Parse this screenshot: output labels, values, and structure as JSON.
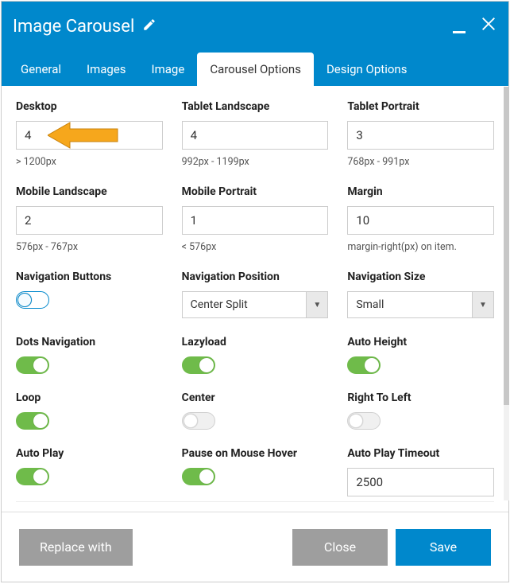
{
  "header": {
    "title": "Image Carousel"
  },
  "tabs": [
    "General",
    "Images",
    "Image",
    "Carousel Options",
    "Design Options"
  ],
  "fields": {
    "desktop": {
      "label": "Desktop",
      "value": "4",
      "helper": "> 1200px"
    },
    "tablet_l": {
      "label": "Tablet Landscape",
      "value": "4",
      "helper": "992px - 1199px"
    },
    "tablet_p": {
      "label": "Tablet Portrait",
      "value": "3",
      "helper": "768px - 991px"
    },
    "mobile_l": {
      "label": "Mobile Landscape",
      "value": "2",
      "helper": "576px - 767px"
    },
    "mobile_p": {
      "label": "Mobile Portrait",
      "value": "1",
      "helper": "< 576px"
    },
    "margin": {
      "label": "Margin",
      "value": "10",
      "helper": "margin-right(px) on item."
    },
    "nav_btns": {
      "label": "Navigation Buttons"
    },
    "nav_pos": {
      "label": "Navigation Position",
      "value": "Center Split"
    },
    "nav_size": {
      "label": "Navigation Size",
      "value": "Small"
    },
    "dots": {
      "label": "Dots Navigation"
    },
    "lazyload": {
      "label": "Lazyload"
    },
    "autoh": {
      "label": "Auto Height"
    },
    "loop": {
      "label": "Loop"
    },
    "center": {
      "label": "Center"
    },
    "rtl": {
      "label": "Right To Left"
    },
    "autoplay": {
      "label": "Auto Play"
    },
    "pause": {
      "label": "Pause on Mouse Hover"
    },
    "timeout": {
      "label": "Auto Play Timeout",
      "value": "2500"
    }
  },
  "footer": {
    "replace": "Replace with",
    "close": "Close",
    "save": "Save"
  }
}
